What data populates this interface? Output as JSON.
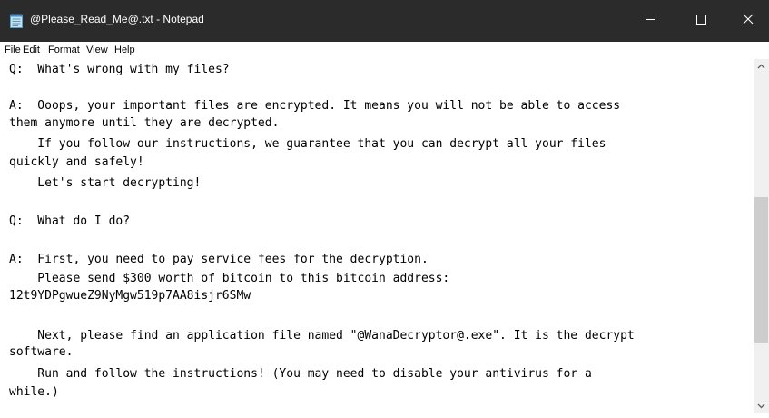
{
  "window": {
    "title": "@Please_Read_Me@.txt - Notepad",
    "icon": "notepad-icon",
    "controls": [
      "minimize-icon",
      "maximize-icon",
      "close-icon"
    ]
  },
  "menu": {
    "items": [
      "File",
      "Edit",
      "Format",
      "View",
      "Help"
    ]
  },
  "document": {
    "lines": [
      "Q:  What's wrong with my files?",
      "",
      "A:  Ooops, your important files are encrypted. It means you will not be able to access",
      "them anymore until they are decrypted.",
      "    If you follow our instructions, we guarantee that you can decrypt all your files",
      "quickly and safely!",
      "    Let's start decrypting!",
      "",
      "Q:  What do I do?",
      "",
      "A:  First, you need to pay service fees for the decryption.",
      "    Please send $300 worth of bitcoin to this bitcoin address:",
      "12t9YDPgwueZ9NyMgw519p7AA8isjr6SMw",
      "",
      "    Next, please find an application file named \"@WanaDecryptor@.exe\". It is the decrypt",
      "software.",
      "    Run and follow the instructions! (You may need to disable your antivirus for a",
      "while.)"
    ]
  },
  "colors": {
    "titlebar": "#2b2b2b",
    "title_text": "#ffffff",
    "editor_bg": "#ffffff",
    "scrollbar_track": "#f0f0f0",
    "scrollbar_thumb": "#cdcdcd"
  }
}
